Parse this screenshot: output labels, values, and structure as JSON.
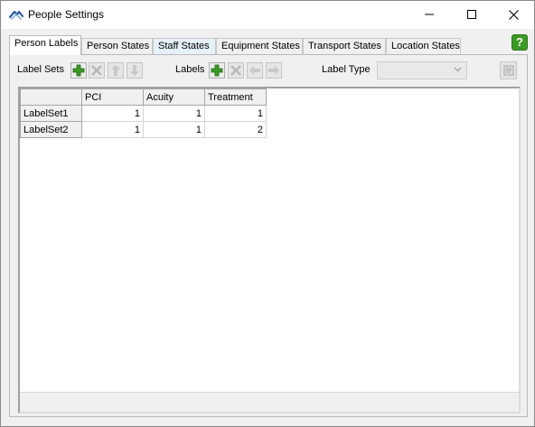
{
  "window": {
    "title": "People Settings",
    "controls": {
      "minimize": "minimize",
      "maximize": "maximize",
      "close": "close"
    }
  },
  "tabs": [
    {
      "label": "Person Labels",
      "active": true
    },
    {
      "label": "Person States",
      "active": false
    },
    {
      "label": "Staff States",
      "active": false,
      "hover": true
    },
    {
      "label": "Equipment States",
      "active": false
    },
    {
      "label": "Transport States",
      "active": false
    },
    {
      "label": "Location States",
      "active": false
    }
  ],
  "help_label": "?",
  "toolbar": {
    "label_sets": "Label Sets",
    "labels": "Labels",
    "label_type": "Label Type",
    "label_type_value": ""
  },
  "grid": {
    "columns": [
      "PCI",
      "Acuity",
      "Treatment"
    ],
    "rows": [
      {
        "name": "LabelSet1",
        "values": [
          "1",
          "1",
          "1"
        ]
      },
      {
        "name": "LabelSet2",
        "values": [
          "1",
          "1",
          "2"
        ]
      }
    ]
  },
  "colors": {
    "accent_green": "#3c9a27",
    "hover_tab": "#e5f1fb"
  }
}
